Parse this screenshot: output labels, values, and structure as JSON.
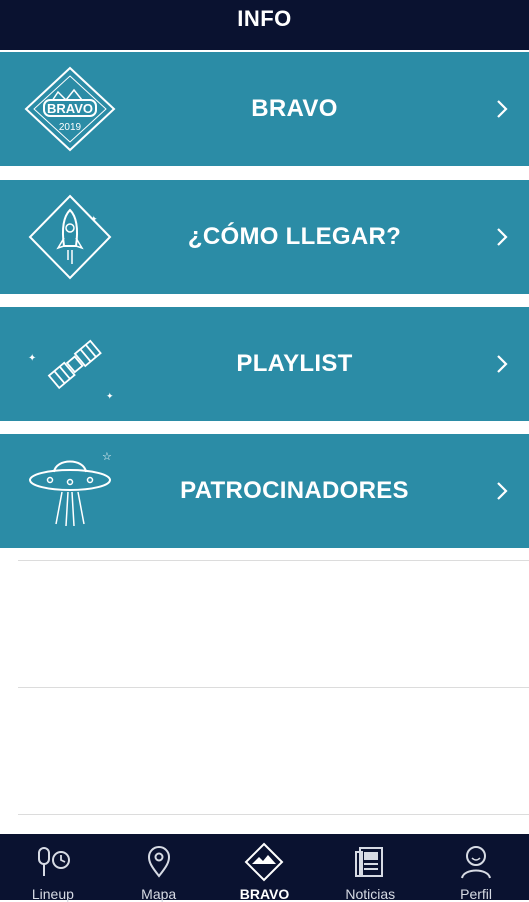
{
  "header": {
    "title": "INFO"
  },
  "menu": [
    {
      "label": "BRAVO",
      "icon": "bravo-2019-badge-icon",
      "badge_text": "BRAVO",
      "badge_year": "2019"
    },
    {
      "label": "¿CÓMO LLEGAR?",
      "icon": "rocket-icon"
    },
    {
      "label": "PLAYLIST",
      "icon": "satellite-icon"
    },
    {
      "label": "PATROCINADORES",
      "icon": "ufo-icon"
    }
  ],
  "tabbar": [
    {
      "label": "Lineup",
      "icon": "microphone-clock-icon",
      "active": false
    },
    {
      "label": "Mapa",
      "icon": "map-pin-icon",
      "active": false
    },
    {
      "label": "BRAVO",
      "icon": "mountain-diamond-icon",
      "active": true
    },
    {
      "label": "Noticias",
      "icon": "newspaper-icon",
      "active": false
    },
    {
      "label": "Perfil",
      "icon": "user-icon",
      "active": false
    }
  ],
  "colors": {
    "header_bg": "#0a1230",
    "item_bg": "#2b8ca6",
    "text": "#ffffff"
  }
}
